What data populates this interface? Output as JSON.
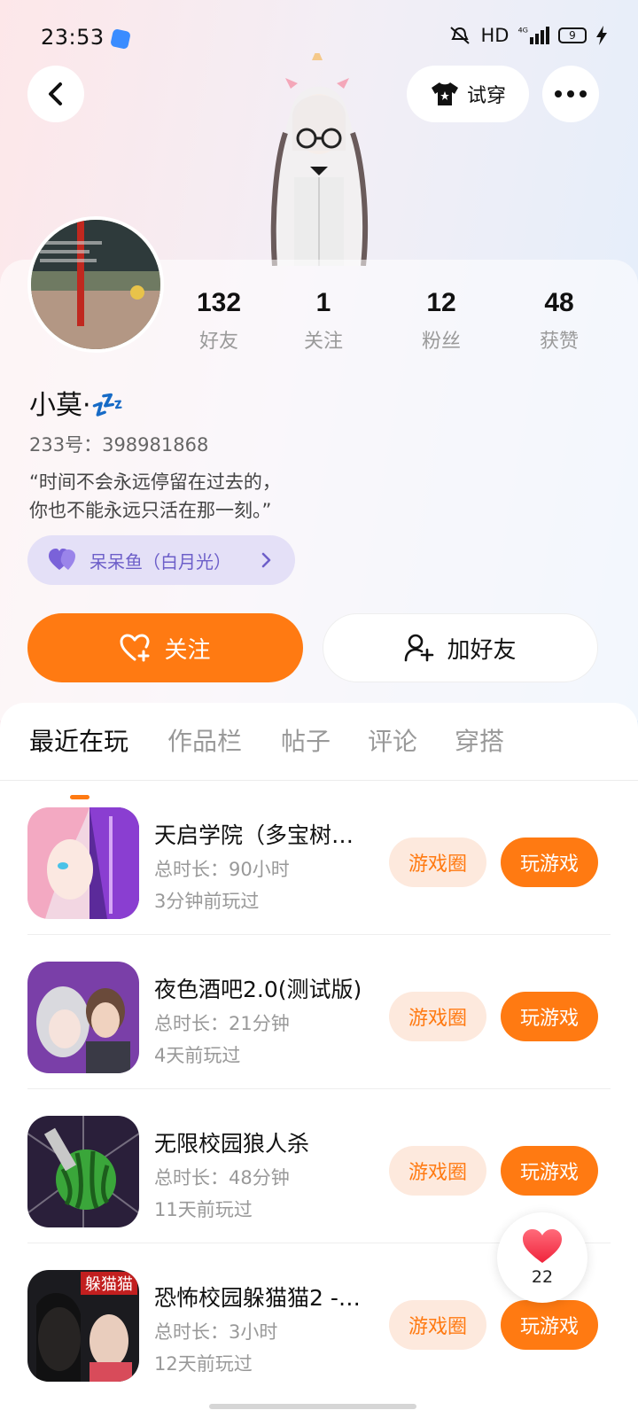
{
  "status_bar": {
    "time": "23:53",
    "network": "HD",
    "signal": "⁴ᴳ",
    "battery": "9"
  },
  "header": {
    "try_on_label": "试穿",
    "icons": [
      "back-arrow-icon",
      "tshirt-icon",
      "more-icon"
    ]
  },
  "profile": {
    "stats": [
      {
        "value": "132",
        "label": "好友"
      },
      {
        "value": "1",
        "label": "关注"
      },
      {
        "value": "12",
        "label": "粉丝"
      },
      {
        "value": "48",
        "label": "获赞"
      }
    ],
    "nickname": "小莫·💤",
    "uid": "233号：398981868",
    "bio_line1": "“时间不会永远停留在过去的，",
    "bio_line2": "你也不能永远只活在那一刻。”",
    "bond_label": "呆呆鱼（白月光）"
  },
  "actions": {
    "follow_label": "关注",
    "add_friend_label": "加好友"
  },
  "tabs": [
    "最近在玩",
    "作品栏",
    "帖子",
    "评论",
    "穿搭"
  ],
  "games": [
    {
      "title": "天启学院（多宝树…",
      "duration": "总时长：90小时",
      "last_played": "3分钟前玩过"
    },
    {
      "title": "夜色酒吧2.0(测试版)",
      "duration": "总时长：21分钟",
      "last_played": "4天前玩过"
    },
    {
      "title": "无限校园狼人杀",
      "duration": "总时长：48分钟",
      "last_played": "11天前玩过"
    },
    {
      "title": "恐怖校园躲猫猫2 -…",
      "duration": "总时长：3小时",
      "last_played": "12天前玩过"
    }
  ],
  "game_buttons": {
    "circle_label": "游戏圈",
    "play_label": "玩游戏"
  },
  "game4_icon_text": "躲猫猫",
  "like": {
    "count": "22"
  },
  "colors": {
    "accent": "#ff7a12",
    "accent_light": "#fde9dd",
    "bond_bg": "#e4e0f7",
    "bond_text": "#6d5fc9"
  }
}
